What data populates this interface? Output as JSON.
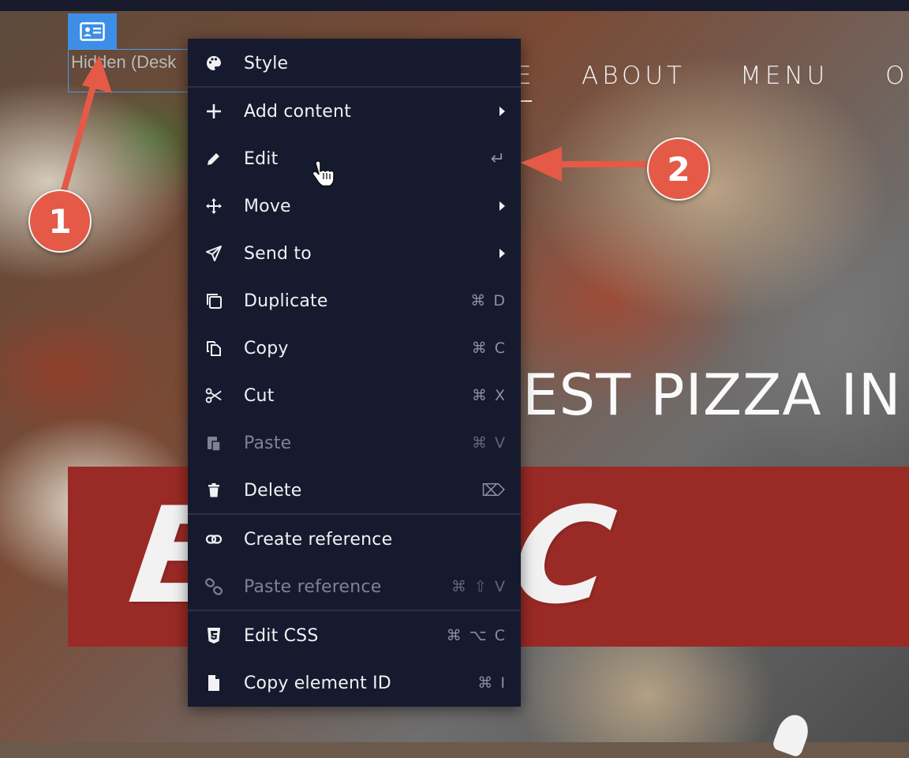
{
  "nav": {
    "items": [
      {
        "label": "E"
      },
      {
        "label": "ABOUT"
      },
      {
        "label": "MENU"
      },
      {
        "label": "O"
      }
    ]
  },
  "hero": {
    "heading_partial": "EST PIZZA IN",
    "brand_partial": "ESPAC"
  },
  "selected_element": {
    "label": "Hidden (Desk",
    "badge_icon": "contact-card-icon"
  },
  "context_menu": {
    "items": [
      {
        "label": "Style",
        "icon": "palette-icon",
        "shortcut": "",
        "submenu": false,
        "disabled": false
      },
      {
        "label": "Add content",
        "icon": "plus-icon",
        "shortcut": "",
        "submenu": true,
        "disabled": false
      },
      {
        "label": "Edit",
        "icon": "pencil-icon",
        "shortcut": "↵",
        "submenu": false,
        "disabled": false
      },
      {
        "label": "Move",
        "icon": "move-arrows-icon",
        "shortcut": "",
        "submenu": true,
        "disabled": false
      },
      {
        "label": "Send to",
        "icon": "send-icon",
        "shortcut": "",
        "submenu": true,
        "disabled": false
      },
      {
        "label": "Duplicate",
        "icon": "duplicate-icon",
        "shortcut": "⌘ D",
        "submenu": false,
        "disabled": false
      },
      {
        "label": "Copy",
        "icon": "copy-icon",
        "shortcut": "⌘ C",
        "submenu": false,
        "disabled": false
      },
      {
        "label": "Cut",
        "icon": "scissors-icon",
        "shortcut": "⌘ X",
        "submenu": false,
        "disabled": false
      },
      {
        "label": "Paste",
        "icon": "paste-icon",
        "shortcut": "⌘ V",
        "submenu": false,
        "disabled": true
      },
      {
        "label": "Delete",
        "icon": "trash-icon",
        "shortcut": "⌦",
        "submenu": false,
        "disabled": false
      },
      {
        "label": "Create reference",
        "icon": "link-icon",
        "shortcut": "",
        "submenu": false,
        "disabled": false
      },
      {
        "label": "Paste reference",
        "icon": "link-broken-icon",
        "shortcut": "⌘ ⇧ V",
        "submenu": false,
        "disabled": true
      },
      {
        "label": "Edit CSS",
        "icon": "css3-icon",
        "shortcut": "⌘ ⌥ C",
        "submenu": false,
        "disabled": false
      },
      {
        "label": "Copy element ID",
        "icon": "document-icon",
        "shortcut": "⌘ I",
        "submenu": false,
        "disabled": false
      }
    ]
  },
  "annotations": [
    {
      "number": "1"
    },
    {
      "number": "2"
    }
  ],
  "colors": {
    "menu_bg": "#161a2e",
    "callout": "#e45a47",
    "selection": "#3d8ee6",
    "banner_red": "#9a2a25"
  }
}
